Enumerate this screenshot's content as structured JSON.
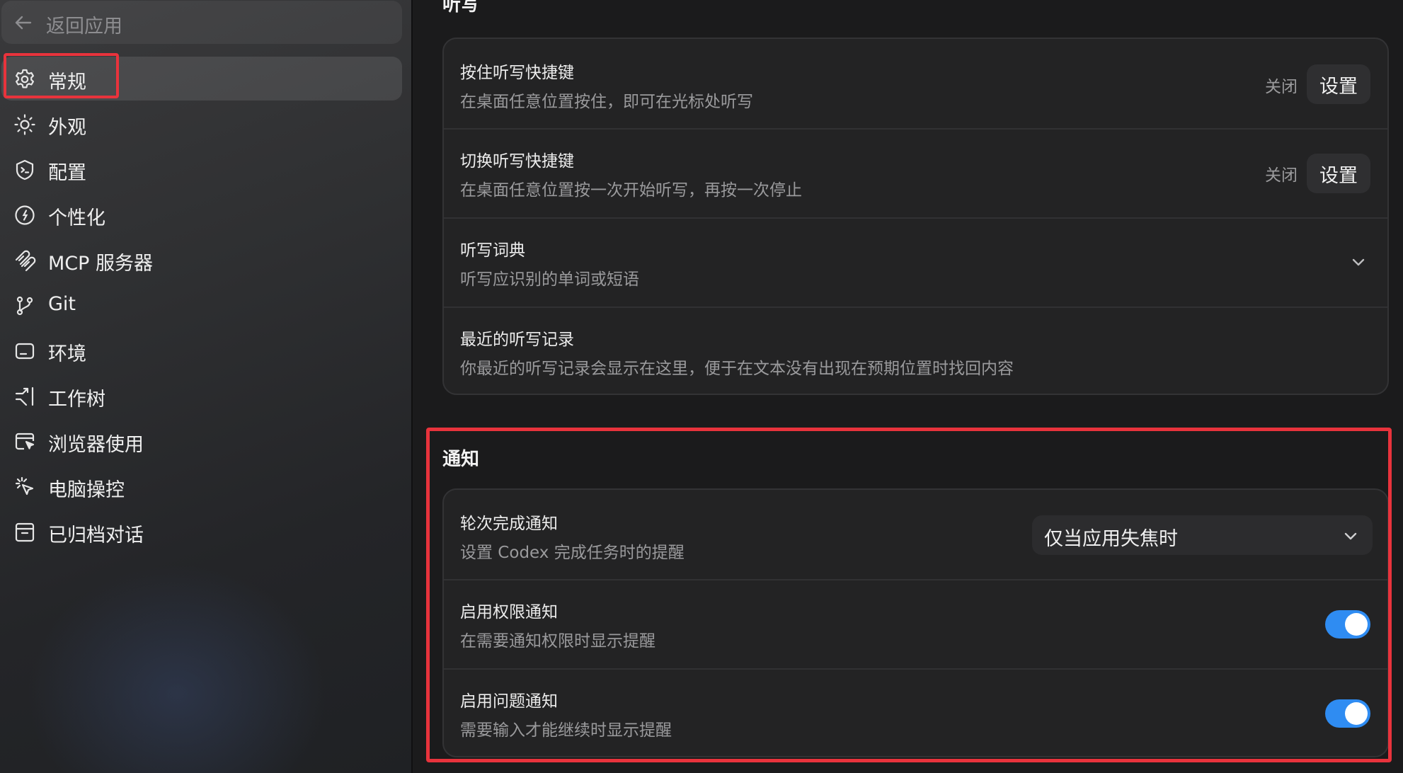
{
  "sidebar": {
    "back_label": "返回应用",
    "items": [
      {
        "label": "常规",
        "icon": "gear-icon"
      },
      {
        "label": "外观",
        "icon": "sun-icon"
      },
      {
        "label": "配置",
        "icon": "shield-terminal-icon"
      },
      {
        "label": "个性化",
        "icon": "personalize-icon"
      },
      {
        "label": "MCP 服务器",
        "icon": "mcp-icon"
      },
      {
        "label": "Git",
        "icon": "git-branch-icon"
      },
      {
        "label": "环境",
        "icon": "environment-icon"
      },
      {
        "label": "工作树",
        "icon": "worktree-icon"
      },
      {
        "label": "浏览器使用",
        "icon": "browser-cursor-icon"
      },
      {
        "label": "电脑操控",
        "icon": "click-pointer-icon"
      },
      {
        "label": "已归档对话",
        "icon": "archive-icon"
      }
    ]
  },
  "dictation": {
    "section_title": "听写",
    "rows": [
      {
        "title": "按住听写快捷键",
        "desc": "在桌面任意位置按住，即可在光标处听写",
        "status": "关闭",
        "button": "设置"
      },
      {
        "title": "切换听写快捷键",
        "desc": "在桌面任意位置按一次开始听写，再按一次停止",
        "status": "关闭",
        "button": "设置"
      },
      {
        "title": "听写词典",
        "desc": "听写应识别的单词或短语"
      },
      {
        "title": "最近的听写记录",
        "desc": "你最近的听写记录会显示在这里，便于在文本没有出现在预期位置时找回内容"
      }
    ]
  },
  "notifications": {
    "section_title": "通知",
    "rows": [
      {
        "title": "轮次完成通知",
        "desc": "设置 Codex 完成任务时的提醒",
        "select_value": "仅当应用失焦时"
      },
      {
        "title": "启用权限通知",
        "desc": "在需要通知权限时显示提醒",
        "toggle_on": true
      },
      {
        "title": "启用问题通知",
        "desc": "需要输入才能继续时显示提醒",
        "toggle_on": true
      }
    ]
  },
  "colors": {
    "highlight": "#e8333c",
    "toggle_on": "#2f8cf2",
    "background": "#1b1b1c"
  }
}
